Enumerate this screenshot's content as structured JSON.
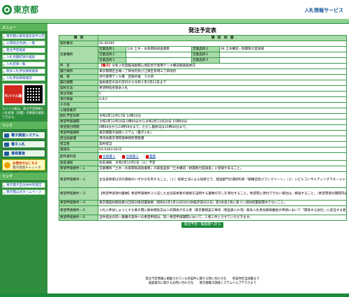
{
  "header": {
    "logo_text": "東京都",
    "service_label": "入札情報サービス",
    "color_brand": "#1a8a3a"
  },
  "sidebar": {
    "menu_heading": "メニュー",
    "menu_items": [
      "東京都公報等発表案件公告",
      "公開発注見通し一覧",
      "発注予定検索",
      "入札見積結果の検索",
      "入札結果一覧",
      "競争入札参加資格検索",
      "入札参加資格確認"
    ],
    "mobile_badge": "モバイル版",
    "mobile_note": "モバイル版は、発注予定情報と入札結果（見積）の情報を検索できます。",
    "link_heading": "リンク",
    "link_items": [
      "電子調達システム(TOP)",
      "電子入札",
      "資格審査"
    ],
    "inquiry_label": "お問合せはこちら",
    "inquiry_sub": "電子調達チャットボット",
    "bottom_heading": "リンク",
    "bottom_items": [
      "東京電子自治体共同運営",
      "東京都公式ホームページ"
    ]
  },
  "main": {
    "title": "発注予定表",
    "col_item": "項　目",
    "col_content": "項　目　内　容",
    "rows": {
      "contract_no_label": "契約番号",
      "contract_no": "02-00381",
      "business_label": "営業種目",
      "business_1": "営業品目１",
      "business_1_val": "124 土木・水系関係調査業務",
      "business_1b": "営業品目１",
      "business_1b_val": "04 土木構造・耐震耐力度調査",
      "business_2": "営業品目２",
      "business_2b": "営業品目２",
      "business_3": "営業品目３",
      "business_3b": "営業品目３",
      "name_label": "件　名",
      "name_tag": "【電子】",
      "name": "令和２年度臨海副都心地区歩行者用デッキ構造検調査委託",
      "place_label": "履行場所",
      "place": "東京都港区台場一丁目地内及び江東区有明三丁目地内",
      "scope_label": "概　要",
      "scope": "歩行者用デッキ橋　定期点検　５か所",
      "period_label": "履行期間",
      "period": "契約確定の日の翌日から令和３年3月12日まで",
      "method_label": "契約方法",
      "method": "希望制指名競争入札",
      "grade_label": "発注等級",
      "grade": "C",
      "grades_label": "受付等級",
      "grades": "A,B,C",
      "other_label": "その他",
      "other": "",
      "pub_label": "公報登載月",
      "pub": "",
      "open_label": "開札予定日時",
      "open": "令和2年12月17日 10時10分",
      "apply_label": "希望申請期間",
      "apply": "令和2年11月16日 0時00分から令和2年11月20日 15時00分",
      "hours_label": "希望受付時間",
      "hours": "0時00分から23時59分まで。ただし最終日は15時00分まで。",
      "apply_place_label": "希望申請場所",
      "apply_place": "東京都電子調達システム（電子入札）",
      "dept_label": "担当局部課",
      "dept": "港湾局東京港管理事務所港務課",
      "staff_label": "担当者",
      "staff": "契約担当",
      "tel_label": "連絡先",
      "tel": "03-5463-0215",
      "pdf_label": "配布資料等",
      "pdf_1": "仕様書１",
      "pdf_2": "仕様書２",
      "pdf_3": "図面",
      "notice_label": "指名通知",
      "notice": "指名通知　令和2年12月1日（火）予定",
      "req1_label": "希望申請要件－１",
      "req1": "営業種目「土木・水系関係調査業務」の取扱品目「土木構造・耐震耐力度調査」に登録があること。",
      "req2_label": "希望申請要件－２",
      "req2": "主任技術者は次の資格のいずれかを有すること。（１）技術士法による技術士で、建設部門の選択科目「鋼構造及びコンクリート」（２）シビルコンサルティングマネージャー（RCCM)の「鋼構造及びコンクリート」部門（ただし、当該部門の実務経験が３年以上の者）",
      "req3_label": "希望申請要件－３",
      "req3": "【希望申請添付書類】希望申請要件２に記した主任技術者の資格を証明する書類の写しを添付すること。希望票に添付できない場合は、郵送すること。（希望票受付期間内必着。〒108-0075東京都港区港南三丁目9番56号　東京都東京港管理事務所港務課契約担当まで）",
      "req4_label": "希望申請要件－４",
      "req4": "東京都契約関係暴力団等対策措置要綱（昭和62年1月14日付61財経庶第922号）第5条第1項に基づく排除措置期間中でないこと。",
      "req5_label": "希望申請要件－５",
      "req5": "入札に参加しようとする者の間に資本関係又は人的関係がある者（東京都建設工事等（物品買入れ等）競争入札参加資格審査の申請において「関係する会社」に該当する者）は入札に参加できません。",
      "req6_label": "希望申請要件－６",
      "req6": "当件発注の同一業種の案件への希望申請は、同一希望申請期間において、１者１件とさせていただきます。"
    },
    "back_label": "発注予定一覧画面へ戻る"
  },
  "footer": {
    "line1": "発注予定情報に掲載されている各案件に関する問い合わせ先　　各案件担当部署まで",
    "line2": "画面操作に関するお問い合わせ先　　東京都電子調達システムヘルプデスクまで"
  }
}
